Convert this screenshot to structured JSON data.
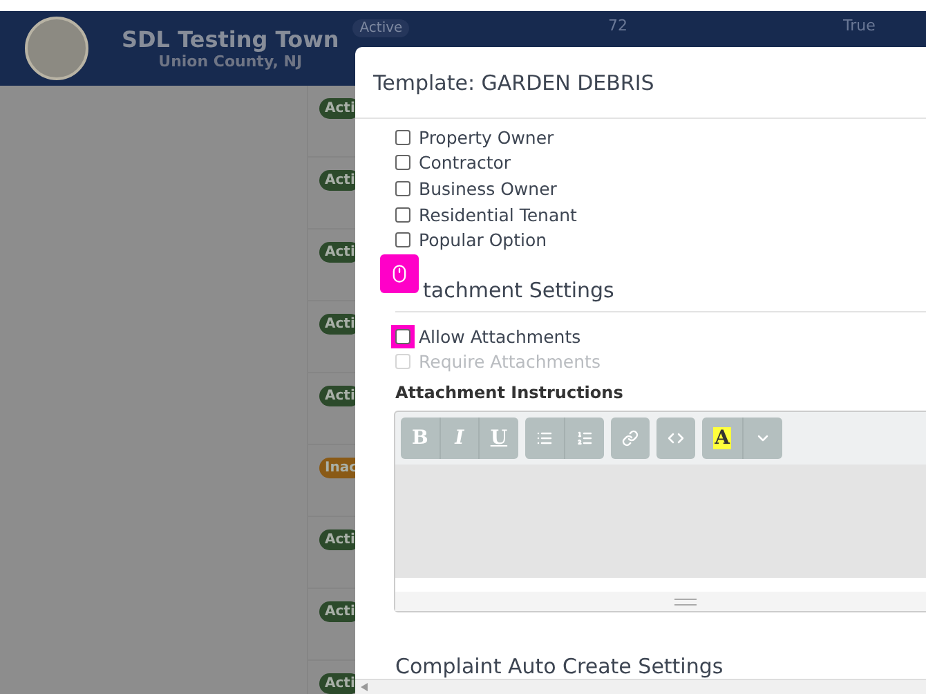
{
  "header": {
    "town": "SDL Testing Town",
    "county": "Union County, NJ",
    "badge": "Active",
    "extra": [
      "72",
      "True"
    ]
  },
  "rows": [
    {
      "status": "Acti",
      "kind": "active"
    },
    {
      "status": "Acti",
      "kind": "active"
    },
    {
      "status": "Acti",
      "kind": "active"
    },
    {
      "status": "Acti",
      "kind": "active"
    },
    {
      "status": "Acti",
      "kind": "active"
    },
    {
      "status": "Inac",
      "kind": "inactive"
    },
    {
      "status": "Acti",
      "kind": "active"
    },
    {
      "status": "Acti",
      "kind": "active"
    },
    {
      "status": "Acti",
      "kind": "active"
    }
  ],
  "modal": {
    "title": "Template: GARDEN DEBRIS",
    "options": [
      {
        "label": "Property Owner",
        "checked": false
      },
      {
        "label": "Contractor",
        "checked": false
      },
      {
        "label": "Business Owner",
        "checked": false
      },
      {
        "label": "Residential Tenant",
        "checked": false
      },
      {
        "label": "Popular Option",
        "checked": false
      }
    ],
    "attachment_heading": "tachment Settings",
    "attachment_options": [
      {
        "label": "Allow Attachments",
        "checked": false,
        "disabled": false,
        "highlighted": true
      },
      {
        "label": "Require Attachments",
        "checked": false,
        "disabled": true,
        "highlighted": false
      }
    ],
    "instructions_label": "Attachment Instructions",
    "toolbar": [
      [
        {
          "kind": "bold",
          "text": "B"
        },
        {
          "kind": "italic",
          "text": "I"
        },
        {
          "kind": "underline",
          "text": "U"
        }
      ],
      [
        {
          "kind": "bullets"
        },
        {
          "kind": "numbers"
        }
      ],
      [
        {
          "kind": "link"
        }
      ],
      [
        {
          "kind": "code"
        }
      ],
      [
        {
          "kind": "highlight",
          "text": "A"
        },
        {
          "kind": "caret"
        }
      ]
    ],
    "next_heading": "Complaint Auto Create Settings"
  }
}
